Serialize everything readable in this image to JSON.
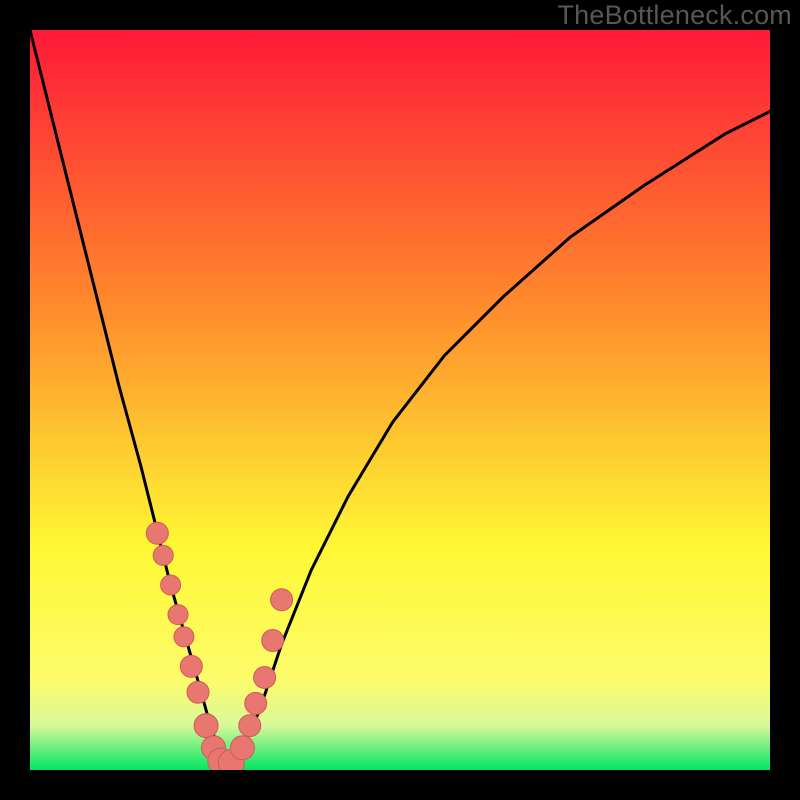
{
  "watermark": "TheBottleneck.com",
  "colors": {
    "frame": "#000000",
    "grad_top": "#fe1938",
    "grad_mid1": "#ff8d2c",
    "grad_mid2": "#fef834",
    "grad_low1": "#fdfc6c",
    "grad_low2": "#d8f99a",
    "grad_bottom": "#02e663",
    "curve": "#000000",
    "dot_fill": "#e77770",
    "dot_stroke": "#cf5b56"
  },
  "chart_data": {
    "type": "line",
    "title": "",
    "xlabel": "",
    "ylabel": "",
    "xlim": [
      0,
      100
    ],
    "ylim": [
      0,
      100
    ],
    "series": [
      {
        "name": "bottleneck-curve",
        "x": [
          0,
          3,
          6,
          9,
          12,
          15,
          17,
          19,
          21,
          23,
          24.5,
          26,
          27,
          28,
          31,
          34,
          38,
          43,
          49,
          56,
          64,
          73,
          83,
          94,
          100
        ],
        "values": [
          100,
          88,
          76,
          64,
          52,
          41,
          33,
          25,
          18,
          11,
          5.5,
          1.8,
          0.5,
          1.5,
          8,
          17,
          27,
          37,
          47,
          56,
          64,
          72,
          79,
          86,
          89
        ]
      }
    ],
    "dots": {
      "name": "highlight-dots",
      "x": [
        17.2,
        18.0,
        19.0,
        20.0,
        20.8,
        21.8,
        22.7,
        23.8,
        24.8,
        25.8,
        27.2,
        28.7,
        29.7,
        30.5,
        31.7,
        32.8,
        34.0
      ],
      "values": [
        32.0,
        29.0,
        25.0,
        21.0,
        18.0,
        14.0,
        10.5,
        6.0,
        3.0,
        1.2,
        1.0,
        3.0,
        6.0,
        9.0,
        12.5,
        17.5,
        23.0
      ],
      "r": [
        11,
        10,
        10,
        10,
        10,
        11,
        11,
        12,
        12,
        13,
        13,
        12,
        11,
        11,
        11,
        11,
        11
      ]
    }
  }
}
